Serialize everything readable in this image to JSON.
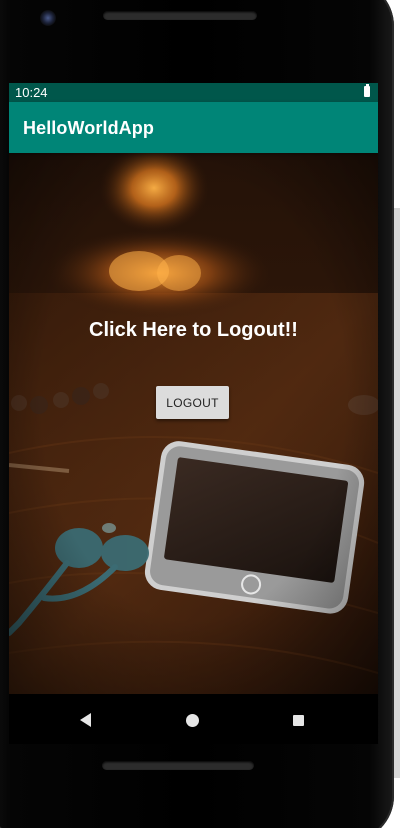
{
  "status_bar": {
    "time": "10:24",
    "icons": [
      "battery-icon"
    ]
  },
  "app_bar": {
    "title": "HelloWorldApp"
  },
  "main": {
    "headline": "Click Here to Logout!!",
    "logout_button_label": "LOGOUT",
    "background": "photo of smartphone and earphones on wooden table with blurred candle light"
  },
  "nav_bar": {
    "icons": [
      "back-icon",
      "home-icon",
      "recents-icon"
    ]
  },
  "colors": {
    "status_bar": "#00574b",
    "app_bar": "#008577",
    "button": "#dcdcdc",
    "headline_text": "#ffffff"
  }
}
